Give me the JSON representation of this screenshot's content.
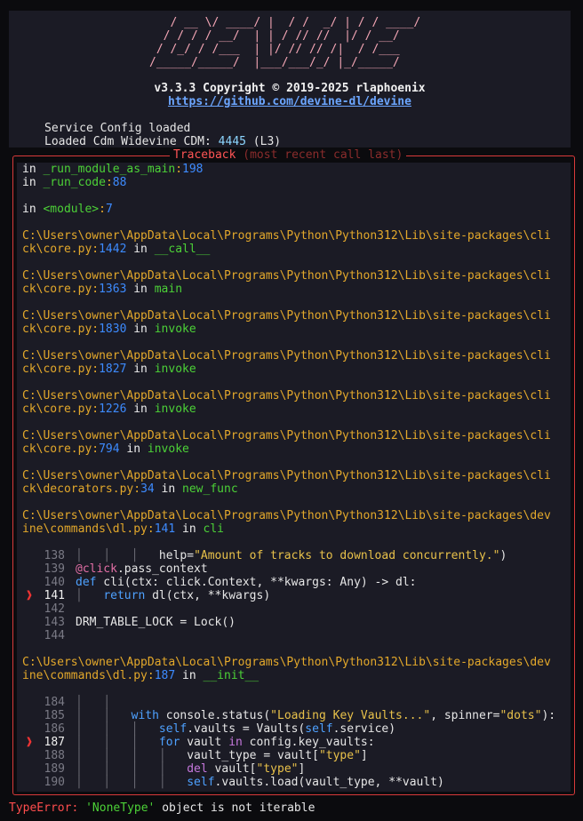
{
  "banner": {
    "logo_lines": [
      "   / __ \\/ ____/ |  / /  _/ | / / ____/",
      "  / / / / __/  | | / // //  |/ / __/   ",
      " / /_/ / /___  | |/ // // /|  / /___   ",
      "/_____/_____/  |___/___/_/ |_/_____/   "
    ],
    "version": "v3.3.3 Copyright © 2019-2025 rlaphoenix",
    "url": "https://github.com/devine-dl/devine",
    "status_service": "Service Config loaded",
    "status_cdm_prefix": "Loaded Cdm Widevine CDM: ",
    "status_cdm_id": "4445",
    "status_cdm_suffix": " (L3)"
  },
  "traceback": {
    "title": "Traceback",
    "subtitle": "(most recent call last)",
    "frames": [
      {
        "path": [
          "in _run_module_as_main"
        ],
        "lineno": "198",
        "fn": "",
        "simple": true
      },
      {
        "path": [
          "in _run_code"
        ],
        "lineno": "88",
        "fn": "",
        "simple": true
      },
      {
        "path": [
          "in <module>"
        ],
        "lineno": "7",
        "fn": "",
        "simple": true
      },
      {
        "path": [
          "C:\\Users\\owner\\AppData\\Local\\Programs\\Python\\Python312\\Lib\\site-packages\\cli",
          "ck\\core.py"
        ],
        "lineno": "1442",
        "fn": "__call__"
      },
      {
        "path": [
          "C:\\Users\\owner\\AppData\\Local\\Programs\\Python\\Python312\\Lib\\site-packages\\cli",
          "ck\\core.py"
        ],
        "lineno": "1363",
        "fn": "main"
      },
      {
        "path": [
          "C:\\Users\\owner\\AppData\\Local\\Programs\\Python\\Python312\\Lib\\site-packages\\cli",
          "ck\\core.py"
        ],
        "lineno": "1830",
        "fn": "invoke"
      },
      {
        "path": [
          "C:\\Users\\owner\\AppData\\Local\\Programs\\Python\\Python312\\Lib\\site-packages\\cli",
          "ck\\core.py"
        ],
        "lineno": "1827",
        "fn": "invoke"
      },
      {
        "path": [
          "C:\\Users\\owner\\AppData\\Local\\Programs\\Python\\Python312\\Lib\\site-packages\\cli",
          "ck\\core.py"
        ],
        "lineno": "1226",
        "fn": "invoke"
      },
      {
        "path": [
          "C:\\Users\\owner\\AppData\\Local\\Programs\\Python\\Python312\\Lib\\site-packages\\cli",
          "ck\\core.py"
        ],
        "lineno": "794",
        "fn": "invoke"
      },
      {
        "path": [
          "C:\\Users\\owner\\AppData\\Local\\Programs\\Python\\Python312\\Lib\\site-packages\\cli",
          "ck\\decorators.py"
        ],
        "lineno": "34",
        "fn": "new_func"
      },
      {
        "path": [
          "C:\\Users\\owner\\AppData\\Local\\Programs\\Python\\Python312\\Lib\\site-packages\\dev",
          "ine\\commands\\dl.py"
        ],
        "lineno": "141",
        "fn": "cli"
      }
    ],
    "code1": {
      "lines": [
        {
          "n": "138",
          "text": "help=\"Amount of tracks to download concurrently.\")"
        },
        {
          "n": "139",
          "text": "@click.pass_context"
        },
        {
          "n": "140",
          "text": "def cli(ctx: click.Context, **kwargs: Any) -> dl:"
        },
        {
          "n": "141",
          "text": "return dl(ctx, **kwargs)"
        },
        {
          "n": "142",
          "text": ""
        },
        {
          "n": "143",
          "text": "DRM_TABLE_LOCK = Lock()"
        },
        {
          "n": "144",
          "text": ""
        }
      ]
    },
    "frame_last": {
      "path": [
        "C:\\Users\\owner\\AppData\\Local\\Programs\\Python\\Python312\\Lib\\site-packages\\dev",
        "ine\\commands\\dl.py"
      ],
      "lineno": "187",
      "fn": "__init__"
    },
    "code2": {
      "lines": [
        {
          "n": "184",
          "text": ""
        },
        {
          "n": "185",
          "text": "with console.status(\"Loading Key Vaults...\", spinner=\"dots\"):"
        },
        {
          "n": "186",
          "text": "self.vaults = Vaults(self.service)"
        },
        {
          "n": "187",
          "text": "for vault in config.key_vaults:"
        },
        {
          "n": "188",
          "text": "vault_type = vault[\"type\"]"
        },
        {
          "n": "189",
          "text": "del vault[\"type\"]"
        },
        {
          "n": "190",
          "text": "self.vaults.load(vault_type, **vault)"
        }
      ]
    }
  },
  "error": {
    "type": "TypeError:",
    "quote": "'NoneType'",
    "message": " object is not iterable"
  },
  "colors": {
    "border": "#d93a3a",
    "path": "#e3a82b",
    "lineno": "#3d8bff",
    "function": "#4cd137",
    "panel": "#1b1b25"
  }
}
